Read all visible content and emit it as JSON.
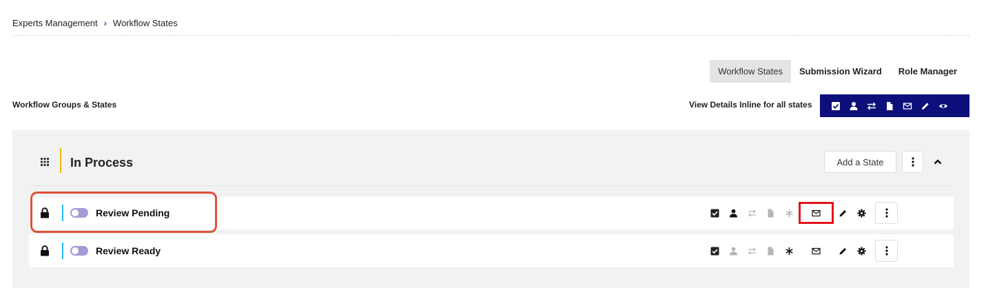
{
  "breadcrumb": {
    "parent": "Experts Management",
    "current": "Workflow States"
  },
  "tabs": [
    {
      "label": "Workflow States",
      "active": true
    },
    {
      "label": "Submission Wizard",
      "active": false
    },
    {
      "label": "Role Manager",
      "active": false
    }
  ],
  "section_title": "Workflow Groups & States",
  "inline_label": "View Details Inline for all states",
  "view_icons": [
    "check-square-icon",
    "person-icon",
    "swap-arrows-icon",
    "document-icon",
    "envelope-icon",
    "pencil-icon",
    "eye-icon"
  ],
  "colors": {
    "view_bar": "#0d0f7a",
    "group_accent": "#f4b400",
    "state_accent": "#29b6f6",
    "toggle": "#a89ad6",
    "highlight_red": "#e0131a",
    "annotation_box": "#de5138"
  },
  "group": {
    "title": "In Process",
    "add_state_label": "Add a State",
    "states": [
      {
        "name": "Review Pending"
      },
      {
        "name": "Review Ready"
      }
    ]
  }
}
